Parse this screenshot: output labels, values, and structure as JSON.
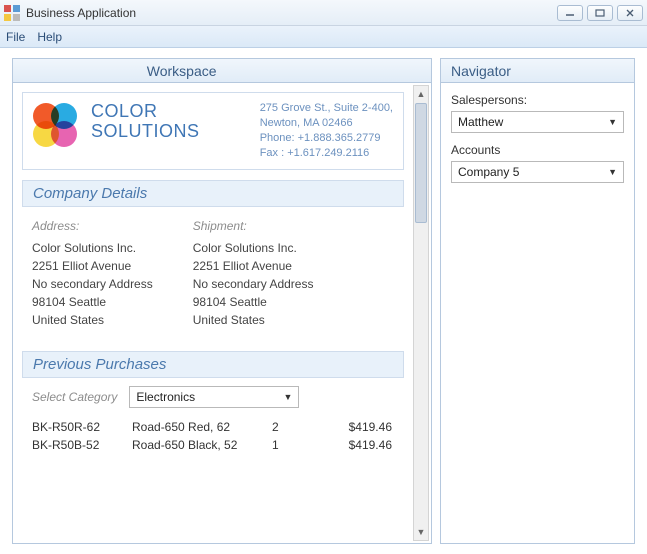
{
  "window": {
    "title": "Business Application"
  },
  "menu": {
    "file": "File",
    "help": "Help"
  },
  "workspace": {
    "title": "Workspace",
    "company": {
      "name_line1": "COLOR",
      "name_line2": "SOLUTIONS",
      "addr": "275 Grove St., Suite 2-400,",
      "city": "Newton, MA 02466",
      "phone": "Phone: +1.888.365.2779",
      "fax": "Fax : +1.617.249.2116"
    },
    "section_details": "Company Details",
    "address_label": "Address:",
    "shipment_label": "Shipment:",
    "address": {
      "l1": "Color Solutions Inc.",
      "l2": "2251 Elliot Avenue",
      "l3": "No secondary Address",
      "l4": "98104 Seattle",
      "l5": "United States"
    },
    "shipment": {
      "l1": "Color Solutions Inc.",
      "l2": "2251 Elliot Avenue",
      "l3": "No secondary Address",
      "l4": "98104 Seattle",
      "l5": "United States"
    },
    "section_purchases": "Previous Purchases",
    "selectcat_label": "Select Category",
    "selectcat_value": "Electronics",
    "purchases": [
      {
        "sku": "BK-R50R-62",
        "name": "Road-650 Red, 62",
        "qty": "2",
        "price": "$419.46"
      },
      {
        "sku": "BK-R50B-52",
        "name": "Road-650 Black, 52",
        "qty": "1",
        "price": "$419.46"
      }
    ]
  },
  "navigator": {
    "title": "Navigator",
    "salespersons_label": "Salespersons:",
    "salespersons_value": "Matthew",
    "accounts_label": "Accounts",
    "accounts_value": "Company 5"
  }
}
